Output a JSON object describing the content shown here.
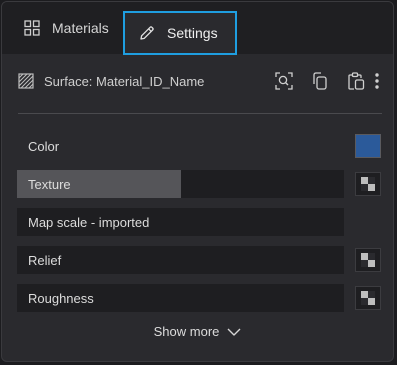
{
  "tabs": {
    "materials": {
      "label": "Materials",
      "icon": "grid-icon"
    },
    "settings": {
      "label": "Settings",
      "icon": "pencil-icon",
      "active": true
    }
  },
  "surface": {
    "label": "Surface: Material_ID_Name",
    "icon": "hatch-icon",
    "actions": [
      "zoom-select-icon",
      "copy-icon",
      "paste-icon",
      "more-vertical-icon"
    ]
  },
  "properties": [
    {
      "label": "Color",
      "control": "color-swatch",
      "color": "#2b5a9a"
    },
    {
      "label": "Texture",
      "control": "texture-button",
      "fill_fraction": 0.5
    },
    {
      "label": "Map scale - imported",
      "control": "none"
    },
    {
      "label": "Relief",
      "control": "texture-button"
    },
    {
      "label": "Roughness",
      "control": "texture-button"
    }
  ],
  "footer": {
    "show_more": "Show more"
  },
  "colors": {
    "accent": "#1f9ee0",
    "panel": "#2a2a2e",
    "row": "#1e1e21",
    "swatch": "#2b5a9a"
  }
}
